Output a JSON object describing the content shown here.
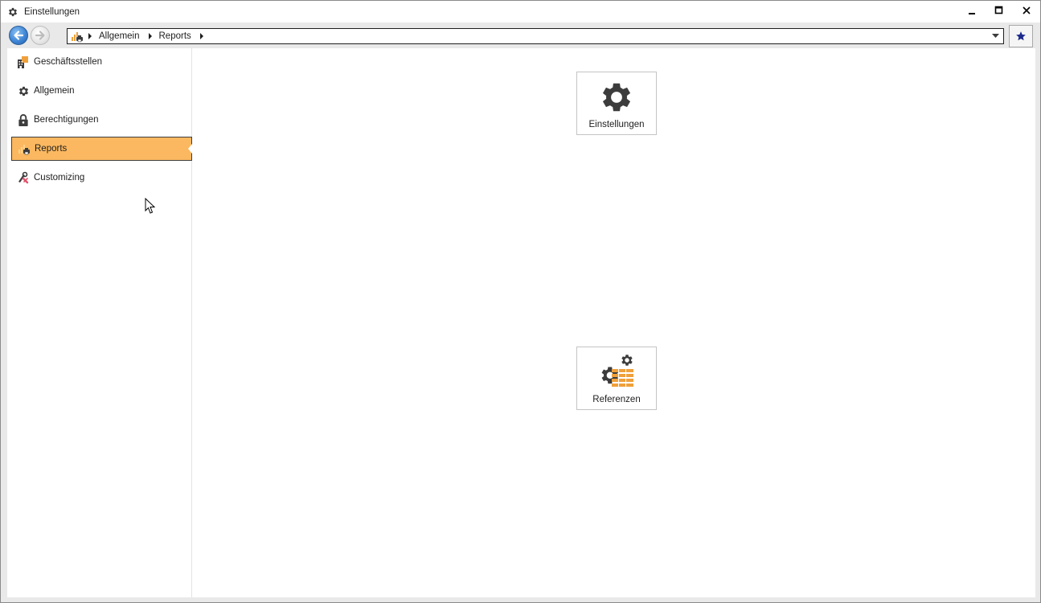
{
  "window": {
    "title": "Einstellungen",
    "icon": "gear-icon"
  },
  "window_controls": {
    "minimize": "minimize-icon",
    "maximize": "maximize-icon",
    "close": "close-icon"
  },
  "navigation": {
    "back_icon": "arrow-left-icon",
    "forward_icon": "arrow-right-icon",
    "breadcrumb": [
      "Allgemein",
      "Reports"
    ],
    "favorites_icon": "star-icon"
  },
  "sidebar": {
    "items": [
      {
        "label": "Geschäftsstellen",
        "icon": "building-icon",
        "active": false
      },
      {
        "label": "Allgemein",
        "icon": "gear-icon",
        "active": false
      },
      {
        "label": "Berechtigungen",
        "icon": "lock-icon",
        "active": false
      },
      {
        "label": "Reports",
        "icon": "report-printer-icon",
        "active": true
      },
      {
        "label": "Customizing",
        "icon": "customizing-icon",
        "active": false
      }
    ]
  },
  "main": {
    "tiles": [
      {
        "label": "Einstellungen",
        "icon": "gear-icon"
      },
      {
        "label": "Referenzen",
        "icon": "gears-table-icon"
      }
    ]
  },
  "colors": {
    "accent": "#fbb860",
    "icon_dark": "#3c3c3c",
    "icon_orange": "#f0a03a",
    "star": "#1c2a8c",
    "back_button": "#3f86d6"
  }
}
